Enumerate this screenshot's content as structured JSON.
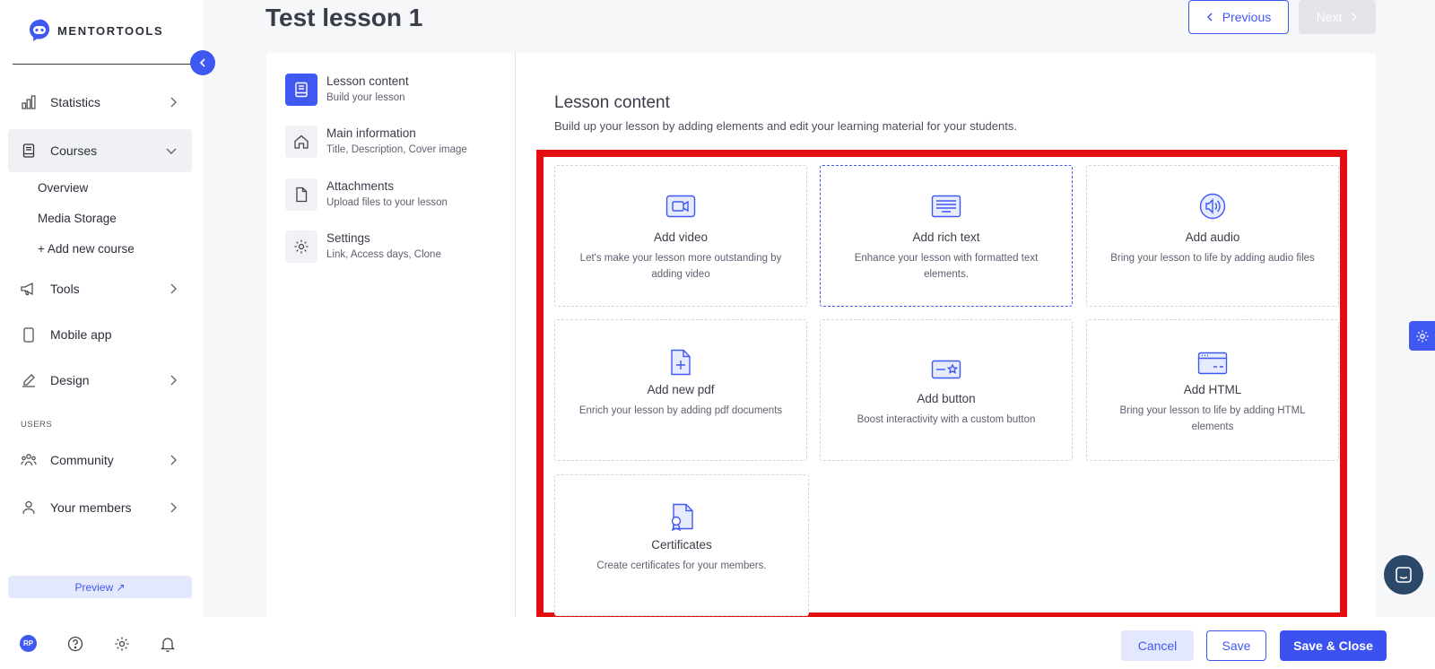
{
  "app": {
    "brand": "MENTORTOOLS",
    "accent": "#4058f2",
    "highlight_color": "#e40d10"
  },
  "sidebar": {
    "nav": [
      {
        "label": "Statistics",
        "icon": "bar-chart-icon"
      },
      {
        "label": "Courses",
        "icon": "book-icon",
        "expanded": true
      },
      {
        "label": "Tools",
        "icon": "megaphone-icon"
      },
      {
        "label": "Mobile app",
        "icon": "phone-icon"
      },
      {
        "label": "Design",
        "icon": "pencil-icon"
      },
      {
        "label": "Community",
        "icon": "users-icon"
      },
      {
        "label": "Your members",
        "icon": "user-icon"
      }
    ],
    "courses_sub": [
      "Overview",
      "Media Storage",
      "+ Add new course"
    ],
    "users_section": "USERS",
    "preview_label": "Preview ↗",
    "avatar_initials": "RP"
  },
  "header": {
    "title": "Test lesson 1",
    "previous_label": "Previous",
    "next_label": "Next"
  },
  "steps": [
    {
      "title": "Lesson content",
      "sub": "Build your lesson",
      "icon": "book-icon",
      "active": true
    },
    {
      "title": "Main information",
      "sub": "Title, Description, Cover image",
      "icon": "home-icon"
    },
    {
      "title": "Attachments",
      "sub": "Upload files to your lesson",
      "icon": "file-icon"
    },
    {
      "title": "Settings",
      "sub": "Link, Access days, Clone",
      "icon": "gear-icon"
    }
  ],
  "content": {
    "title": "Lesson content",
    "subtitle": "Build up your lesson by adding elements and edit your learning material for your students.",
    "tiles": [
      {
        "title": "Add video",
        "desc": "Let's make your lesson more outstanding by adding video",
        "icon": "video-icon"
      },
      {
        "title": "Add rich text",
        "desc": "Enhance your lesson with formatted text elements.",
        "icon": "text-icon",
        "selected": true
      },
      {
        "title": "Add audio",
        "desc": "Bring your lesson to life by adding audio files",
        "icon": "audio-icon"
      },
      {
        "title": "Add new pdf",
        "desc": "Enrich your lesson by adding pdf documents",
        "icon": "pdf-icon"
      },
      {
        "title": "Add button",
        "desc": "Boost interactivity with a custom button",
        "icon": "button-icon"
      },
      {
        "title": "Add HTML",
        "desc": "Bring your lesson to life by adding HTML elements",
        "icon": "html-icon"
      },
      {
        "title": "Certificates",
        "desc": "Create certificates for your members.",
        "icon": "certificate-icon"
      }
    ]
  },
  "footer": {
    "cancel_label": "Cancel",
    "save_label": "Save",
    "save_close_label": "Save & Close"
  }
}
